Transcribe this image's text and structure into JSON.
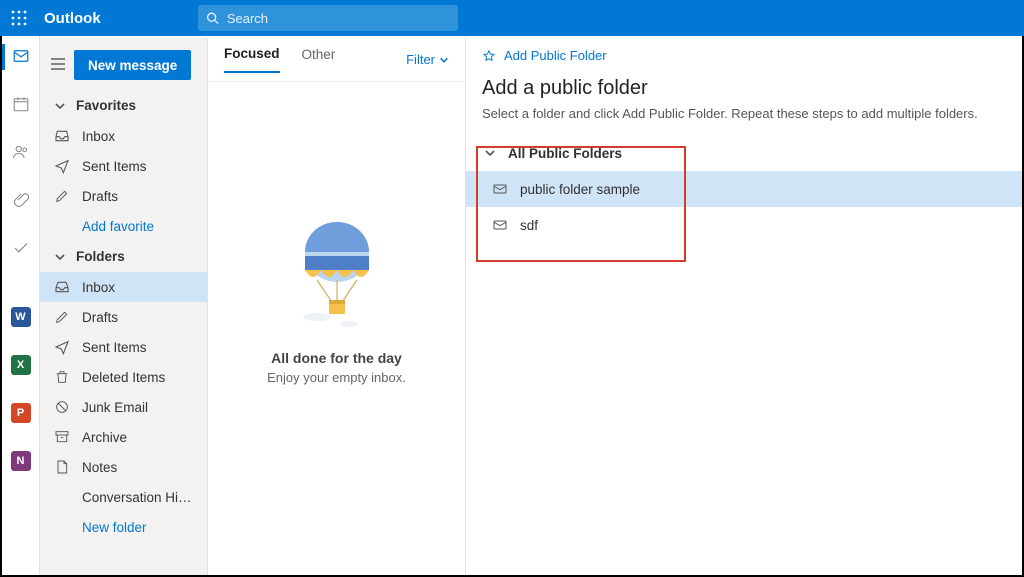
{
  "header": {
    "brand": "Outlook",
    "search_placeholder": "Search"
  },
  "sidebar": {
    "new_message": "New message",
    "favorites_label": "Favorites",
    "favorites": [
      {
        "label": "Inbox",
        "icon": "inbox"
      },
      {
        "label": "Sent Items",
        "icon": "sent"
      },
      {
        "label": "Drafts",
        "icon": "draft"
      }
    ],
    "add_favorite": "Add favorite",
    "folders_label": "Folders",
    "folders": [
      {
        "label": "Inbox",
        "icon": "inbox-open",
        "selected": true
      },
      {
        "label": "Drafts",
        "icon": "draft"
      },
      {
        "label": "Sent Items",
        "icon": "sent"
      },
      {
        "label": "Deleted Items",
        "icon": "trash"
      },
      {
        "label": "Junk Email",
        "icon": "junk"
      },
      {
        "label": "Archive",
        "icon": "archive"
      },
      {
        "label": "Notes",
        "icon": "note"
      },
      {
        "label": "Conversation Hist...",
        "icon": ""
      }
    ],
    "new_folder": "New folder"
  },
  "messages": {
    "tab_focused": "Focused",
    "tab_other": "Other",
    "filter_label": "Filter",
    "empty_headline": "All done for the day",
    "empty_sub": "Enjoy your empty inbox."
  },
  "panel": {
    "add_link": "Add Public Folder",
    "title": "Add a public folder",
    "instructions": "Select a folder and click Add Public Folder. Repeat these steps to add multiple folders.",
    "root_label": "All Public Folders",
    "items": [
      {
        "label": "public folder sample",
        "selected": true
      },
      {
        "label": "sdf",
        "selected": false
      }
    ]
  },
  "rail": {
    "apps": [
      "W",
      "X",
      "P",
      "N"
    ]
  }
}
